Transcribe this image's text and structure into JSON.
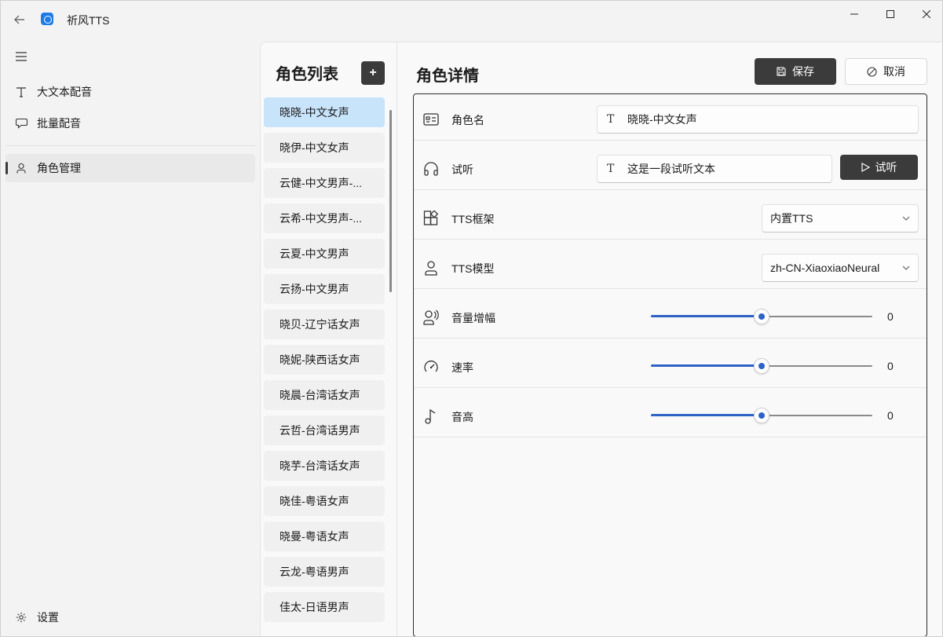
{
  "app": {
    "title": "祈风TTS"
  },
  "nav": {
    "items": [
      {
        "label": "大文本配音",
        "icon": "text-icon"
      },
      {
        "label": "批量配音",
        "icon": "chat-bubble-icon"
      },
      {
        "label": "角色管理",
        "icon": "person-icon"
      }
    ],
    "settings_label": "设置",
    "active_index": 2
  },
  "role_list": {
    "title": "角色列表",
    "add_label": "+",
    "items": [
      "晓晓-中文女声",
      "晓伊-中文女声",
      "云健-中文男声-...",
      "云希-中文男声-...",
      "云夏-中文男声",
      "云扬-中文男声",
      "晓贝-辽宁话女声",
      "晓妮-陕西话女声",
      "晓晨-台湾话女声",
      "云哲-台湾话男声",
      "晓芋-台湾话女声",
      "晓佳-粤语女声",
      "晓曼-粤语女声",
      "云龙-粤语男声",
      "佳太-日语男声"
    ],
    "selected_index": 0
  },
  "detail": {
    "title": "角色详情",
    "save_label": "保存",
    "cancel_label": "取消",
    "role_name": {
      "label": "角色名",
      "value": "晓晓-中文女声"
    },
    "preview": {
      "label": "试听",
      "value": "这是一段试听文本",
      "button_label": "试听"
    },
    "framework": {
      "label": "TTS框架",
      "value": "内置TTS"
    },
    "model": {
      "label": "TTS模型",
      "value": "zh-CN-XiaoxiaoNeural"
    },
    "volume": {
      "label": "音量增幅",
      "value": "0",
      "fraction": 0.5
    },
    "rate": {
      "label": "速率",
      "value": "0",
      "fraction": 0.5
    },
    "pitch": {
      "label": "音高",
      "value": "0",
      "fraction": 0.5
    }
  },
  "colors": {
    "accent": "#2d62c7",
    "dark_button": "#3b3b3b",
    "selected_item": "#c8e4fb"
  }
}
